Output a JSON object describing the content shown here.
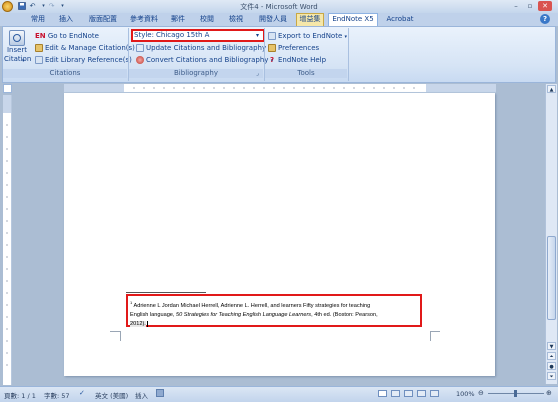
{
  "window": {
    "title": "文件4 - Microsoft Word"
  },
  "quick_access": [
    "save-icon",
    "undo-icon",
    "redo-icon"
  ],
  "tabs": [
    {
      "label": "常用"
    },
    {
      "label": "插入"
    },
    {
      "label": "版面配置"
    },
    {
      "label": "參考資料"
    },
    {
      "label": "郵件"
    },
    {
      "label": "校閱"
    },
    {
      "label": "檢視"
    },
    {
      "label": "開發人員"
    },
    {
      "label": "增益集"
    },
    {
      "label": "EndNote X5"
    },
    {
      "label": "Acrobat"
    }
  ],
  "active_tab": "EndNote X5",
  "ribbon": {
    "citations": {
      "insert_label_1": "Insert",
      "insert_label_2": "Citation",
      "go_to": "Go to EndNote",
      "go_to_prefix": "EN",
      "edit_manage": "Edit & Manage Citation(s)",
      "edit_library": "Edit Library Reference(s)",
      "group_label": "Citations"
    },
    "bibliography": {
      "style_label": "Style:",
      "style_value": "Chicago 15th A",
      "update": "Update Citations and Bibliography",
      "convert": "Convert Citations and Bibliography",
      "group_label": "Bibliography"
    },
    "tools": {
      "export": "Export to EndNote",
      "preferences": "Preferences",
      "help": "EndNote Help",
      "group_label": "Tools"
    }
  },
  "document": {
    "footnote_marker": "1",
    "footnote_line1": "Adrienne L Jordan Michael Herrell, Adrienne L. Herrell, and learners Fifty strategies for teaching",
    "footnote_line2_plain": "English language, ",
    "footnote_line2_italic": "50 Strategies for Teaching English Language Learners",
    "footnote_line2_end": ", 4th ed. (Boston: Pearson,",
    "footnote_line3": "2012)."
  },
  "status": {
    "page": "頁數: 1 / 1",
    "words": "字數: 57",
    "language": "英文 (美國)",
    "mode": "插入",
    "zoom": "100%"
  }
}
